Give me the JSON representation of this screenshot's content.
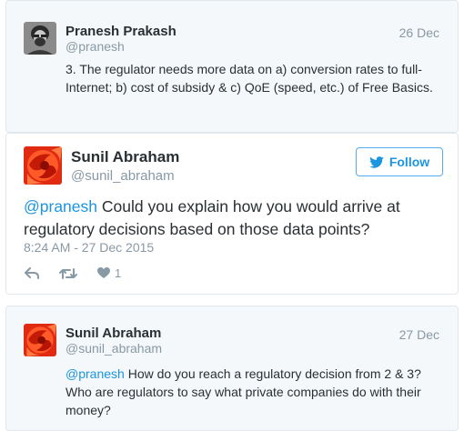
{
  "tweets": [
    {
      "name": "Pranesh Prakash",
      "handle": "@pranesh",
      "date": "26 Dec",
      "text": "3. The regulator needs more data on a) conversion rates to full-Internet; b) cost of subsidy & c) QoE (speed, etc.) of Free Basics."
    },
    {
      "name": "Sunil Abraham",
      "handle": "@sunil_abraham",
      "follow_label": "Follow",
      "mention": "@pranesh",
      "text": " Could you explain how you would arrive at regulatory decisions based on those data points?",
      "timestamp": "8:24 AM - 27 Dec 2015",
      "like_count": "1"
    },
    {
      "name": "Sunil Abraham",
      "handle": "@sunil_abraham",
      "date": "27 Dec",
      "mention": "@pranesh",
      "text": " How do you reach a regulatory decision from 2 & 3? Who are regulators to say what private companies do with their money?"
    }
  ],
  "icons": {
    "reply": "reply-icon",
    "retweet": "retweet-icon",
    "like": "heart-icon",
    "follow": "twitter-bird-icon"
  },
  "colors": {
    "accent": "#1b95e0",
    "muted": "#8899a6",
    "text": "#292f33",
    "border": "#e1e8ed"
  }
}
